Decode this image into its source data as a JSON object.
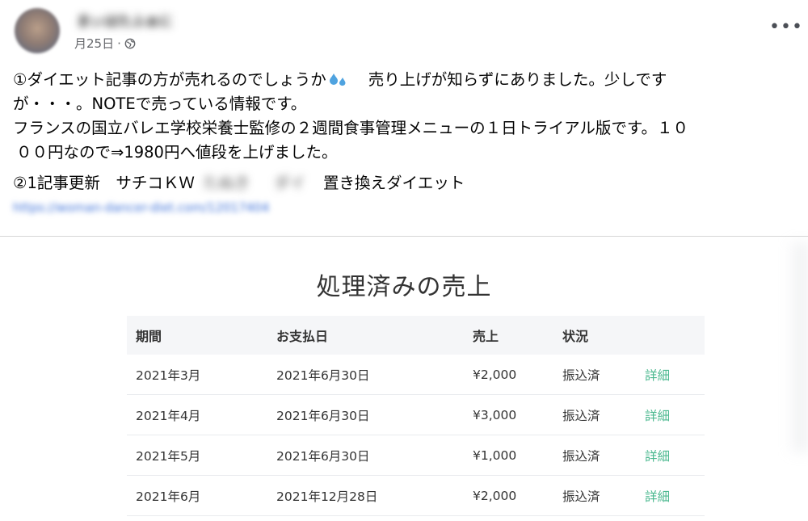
{
  "post": {
    "author_name": "まぃはたふぁに",
    "date": "月25日",
    "separator": "·",
    "privacy_icon": "globe-icon",
    "more_icon": "more-horizontal-icon",
    "more_label": "•••",
    "para1_a": "①ダイエット記事の方が売れるのでしょうか",
    "droplet_icon": "sweat-droplets-icon",
    "para1_b": "売り上げが知らずにありました。少しです",
    "para1_c": "が・・・。NOTEで売っている情報です。",
    "para1_d": "フランスの国立バレエ学校栄養士監修の２週間食事管理メニューの１日トライアル版です。１０",
    "para1_e": "００円なので⇒1980円へ値段を上げました。",
    "para2_a": "②1記事更新　サチコＫＷ",
    "para2_blur1": "たぬき",
    "para2_blur2": "ダイ",
    "para2_b": "置き換えダイエット",
    "link": "https://woman-dancer-diet.com/12017404"
  },
  "sales_panel": {
    "title": "処理済みの売上",
    "columns": [
      "期間",
      "お支払日",
      "売上",
      "状況",
      ""
    ],
    "rows": [
      {
        "period": "2021年3月",
        "payment_date": "2021年6月30日",
        "amount": "¥2,000",
        "status": "振込済",
        "action": "詳細"
      },
      {
        "period": "2021年4月",
        "payment_date": "2021年6月30日",
        "amount": "¥3,000",
        "status": "振込済",
        "action": "詳細"
      },
      {
        "period": "2021年5月",
        "payment_date": "2021年6月30日",
        "amount": "¥1,000",
        "status": "振込済",
        "action": "詳細"
      },
      {
        "period": "2021年6月",
        "payment_date": "2021年12月28日",
        "amount": "¥2,000",
        "status": "振込済",
        "action": "詳細"
      }
    ]
  },
  "colors": {
    "link_blue": "#3a6fd8",
    "detail_green": "#4bb88f",
    "header_row_bg": "#f5f6f8"
  }
}
